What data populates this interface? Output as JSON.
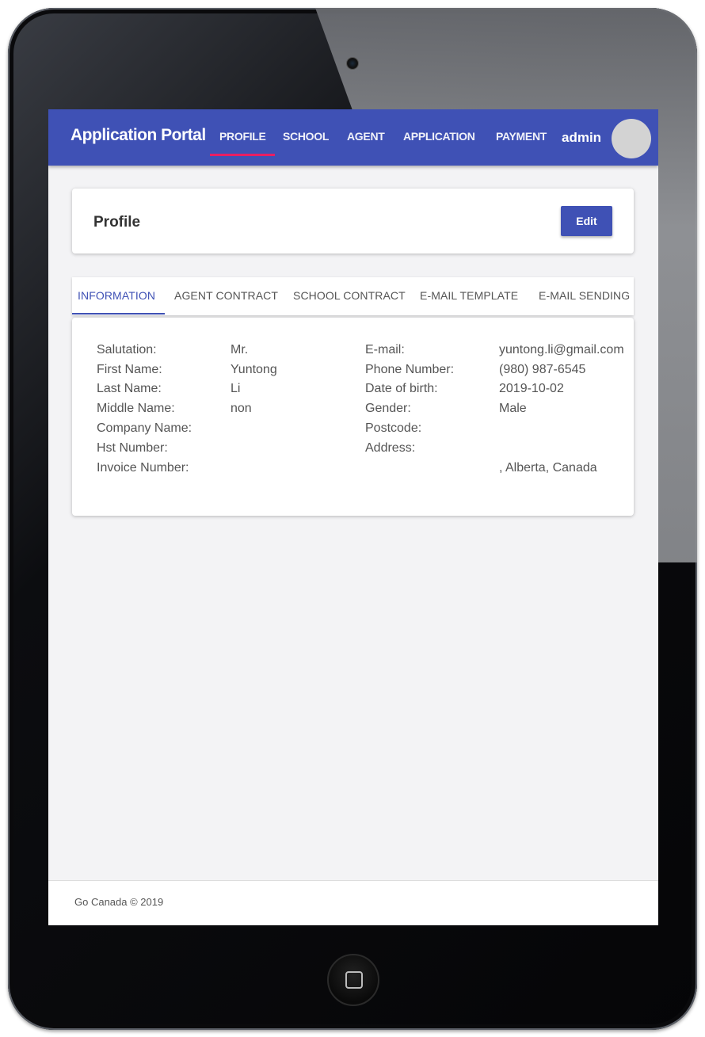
{
  "header": {
    "brand": "Application Portal",
    "nav": [
      "PROFILE",
      "SCHOOL",
      "AGENT",
      "APPLICATION",
      "PAYMENT"
    ],
    "active_nav": "PROFILE",
    "user": "admin"
  },
  "profile_card": {
    "title": "Profile",
    "edit_label": "Edit"
  },
  "tabs": [
    "INFORMATION",
    "AGENT CONTRACT",
    "SCHOOL CONTRACT",
    "E-MAIL TEMPLATE",
    "E-MAIL SENDING"
  ],
  "info": {
    "left": [
      {
        "label": "Salutation:",
        "value": "Mr."
      },
      {
        "label": "First Name:",
        "value": "Yuntong"
      },
      {
        "label": "Last Name:",
        "value": "Li"
      },
      {
        "label": "Middle Name:",
        "value": "non"
      },
      {
        "label": "Company Name:",
        "value": ""
      },
      {
        "label": "Hst Number:",
        "value": ""
      },
      {
        "label": "Invoice Number:",
        "value": ""
      }
    ],
    "right": [
      {
        "label": "E-mail:",
        "value": "yuntong.li@gmail.com"
      },
      {
        "label": "Phone Number:",
        "value": "(980) 987-6545"
      },
      {
        "label": "Date of birth:",
        "value": "2019-10-02"
      },
      {
        "label": "Gender:",
        "value": "Male"
      },
      {
        "label": "Postcode:",
        "value": ""
      },
      {
        "label": "Address:",
        "value": ""
      },
      {
        "label": "",
        "value": ", Alberta, Canada"
      }
    ]
  },
  "footer": {
    "text": "Go Canada © 2019"
  }
}
